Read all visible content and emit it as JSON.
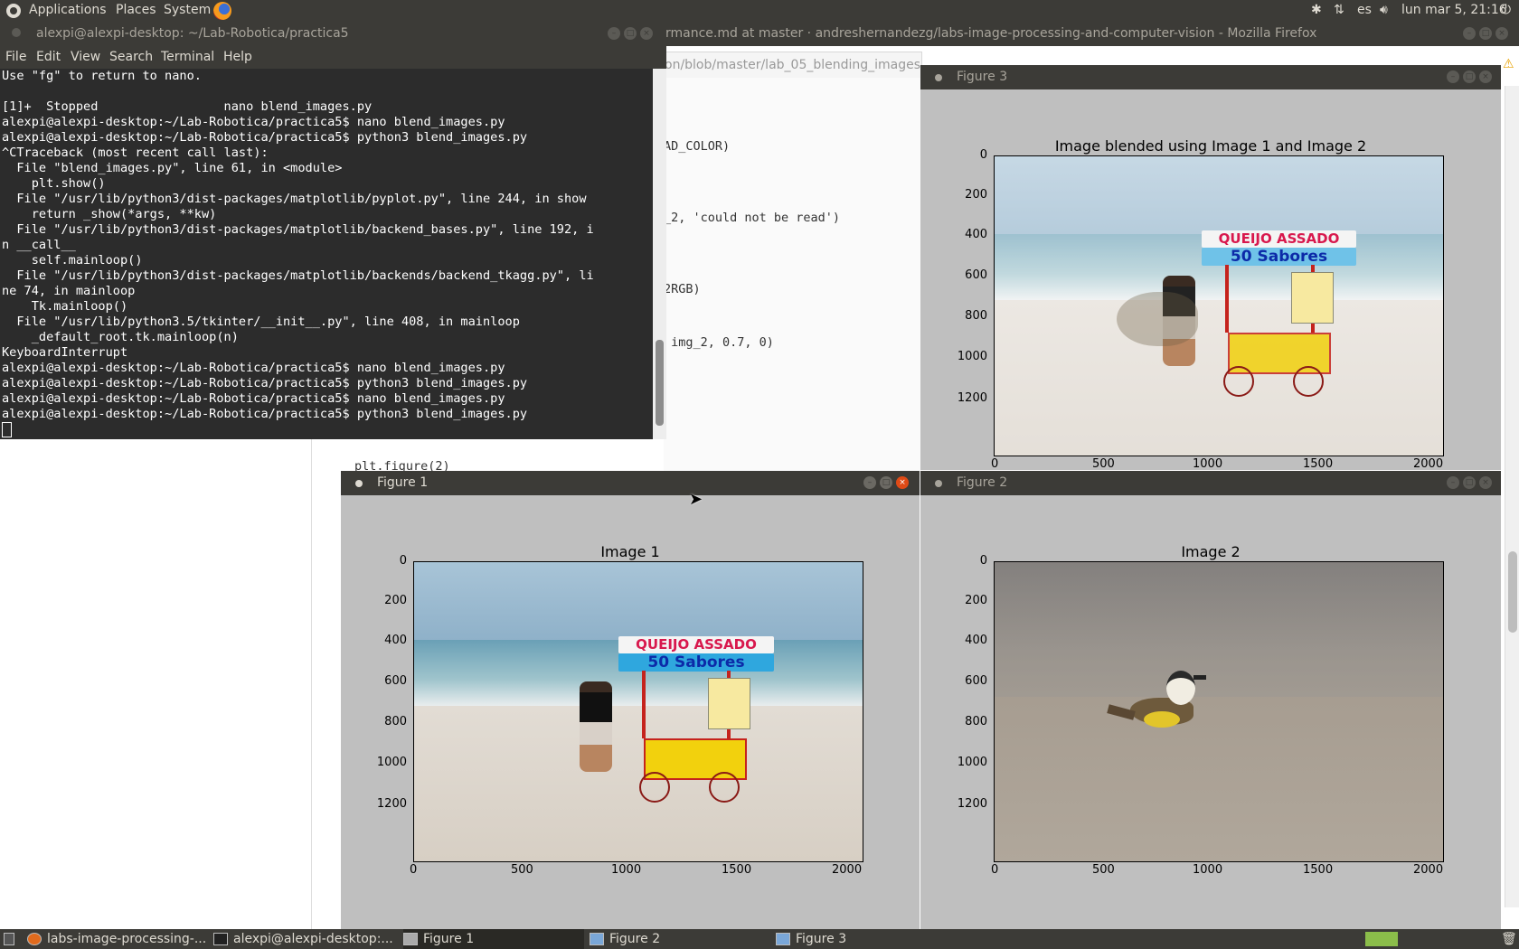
{
  "top_panel": {
    "menus": [
      "Applications",
      "Places",
      "System"
    ],
    "keyboard_layout": "es",
    "clock": "lun mar  5, 21:16"
  },
  "firefox": {
    "title": "rmance.md at master · andreshernandezg/labs-image-processing-and-computer-vision - Mozilla Firefox",
    "url_fragment": "on/blob/master/lab_05_blending_images",
    "code_lines": [
      {
        "text": "AD_COLOR)"
      },
      {
        "text": "_2, 'could not be read')"
      },
      {
        "text": "2RGB)"
      },
      {
        "text": " img_2, 0.7, 0)"
      }
    ],
    "code_bottom": "plt.figure(2)"
  },
  "terminal": {
    "title": "alexpi@alexpi-desktop: ~/Lab-Robotica/practica5",
    "menus": [
      "File",
      "Edit",
      "View",
      "Search",
      "Terminal",
      "Help"
    ],
    "lines": [
      "Use \"fg\" to return to nano.",
      "",
      "[1]+  Stopped                 nano blend_images.py",
      "alexpi@alexpi-desktop:~/Lab-Robotica/practica5$ nano blend_images.py",
      "alexpi@alexpi-desktop:~/Lab-Robotica/practica5$ python3 blend_images.py",
      "^CTraceback (most recent call last):",
      "  File \"blend_images.py\", line 61, in <module>",
      "    plt.show()",
      "  File \"/usr/lib/python3/dist-packages/matplotlib/pyplot.py\", line 244, in show",
      "    return _show(*args, **kw)",
      "  File \"/usr/lib/python3/dist-packages/matplotlib/backend_bases.py\", line 192, i",
      "n __call__",
      "    self.mainloop()",
      "  File \"/usr/lib/python3/dist-packages/matplotlib/backends/backend_tkagg.py\", li",
      "ne 74, in mainloop",
      "    Tk.mainloop()",
      "  File \"/usr/lib/python3.5/tkinter/__init__.py\", line 408, in mainloop",
      "    _default_root.tk.mainloop(n)",
      "KeyboardInterrupt",
      "alexpi@alexpi-desktop:~/Lab-Robotica/practica5$ nano blend_images.py",
      "alexpi@alexpi-desktop:~/Lab-Robotica/practica5$ python3 blend_images.py",
      "alexpi@alexpi-desktop:~/Lab-Robotica/practica5$ nano blend_images.py",
      "alexpi@alexpi-desktop:~/Lab-Robotica/practica5$ python3 blend_images.py"
    ]
  },
  "figures": {
    "fig3": {
      "window_title": "Figure 3",
      "plot_title": "Image blended using Image 1 and Image 2"
    },
    "fig1": {
      "window_title": "Figure 1",
      "plot_title": "Image 1"
    },
    "fig2": {
      "window_title": "Figure 2",
      "plot_title": "Image 2"
    },
    "yticks": [
      "0",
      "200",
      "400",
      "600",
      "800",
      "1000",
      "1200"
    ],
    "xticks": [
      "0",
      "500",
      "1000",
      "1500",
      "2000"
    ],
    "sign_line1": "QUEIJO ASSADO",
    "sign_line2": "50 Sabores"
  },
  "taskbar": {
    "tasks": [
      "labs-image-processing-...",
      "alexpi@alexpi-desktop:...",
      "Figure 1",
      "Figure 2",
      "Figure 3"
    ]
  },
  "colors": {
    "panel": "#3c3b37",
    "terminal_bg": "#2c2c2c",
    "figure_bg": "#bfbfbf",
    "close_button": "#df4a16"
  }
}
